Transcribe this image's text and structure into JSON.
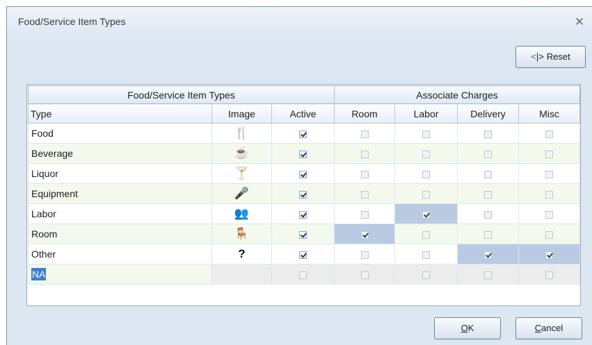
{
  "window": {
    "title": "Food/Service Item Types",
    "close_glyph": "✕"
  },
  "toolbar": {
    "reset_label": "Reset",
    "reset_icon": "reset-arrows-icon"
  },
  "grid": {
    "band1": "Food/Service Item Types",
    "band2": "Associate Charges",
    "columns": [
      "Type",
      "Image",
      "Active",
      "Room",
      "Labor",
      "Delivery",
      "Misc"
    ],
    "rows": [
      {
        "type": "Food",
        "icon": "fork-knife-icon",
        "glyph": "🍴",
        "active": true,
        "room": false,
        "labor": false,
        "delivery": false,
        "misc": false
      },
      {
        "type": "Beverage",
        "icon": "cup-icon",
        "glyph": "☕",
        "active": true,
        "room": false,
        "labor": false,
        "delivery": false,
        "misc": false
      },
      {
        "type": "Liquor",
        "icon": "cocktail-icon",
        "glyph": "🍸",
        "active": true,
        "room": false,
        "labor": false,
        "delivery": false,
        "misc": false
      },
      {
        "type": "Equipment",
        "icon": "microphone-icon",
        "glyph": "🎤",
        "active": true,
        "room": false,
        "labor": false,
        "delivery": false,
        "misc": false
      },
      {
        "type": "Labor",
        "icon": "people-icon",
        "glyph": "👥",
        "active": true,
        "room": false,
        "labor": true,
        "delivery": false,
        "misc": false
      },
      {
        "type": "Room",
        "icon": "table-icon",
        "glyph": "🪑",
        "active": true,
        "room": true,
        "labor": false,
        "delivery": false,
        "misc": false
      },
      {
        "type": "Other",
        "icon": "question-icon",
        "glyph": "?",
        "active": true,
        "room": false,
        "labor": false,
        "delivery": true,
        "misc": true
      }
    ],
    "new_row": {
      "type": "NA"
    }
  },
  "footer": {
    "ok_label": "OK",
    "ok_mnemonic": "O",
    "cancel_label": "Cancel",
    "cancel_mnemonic": "C"
  }
}
